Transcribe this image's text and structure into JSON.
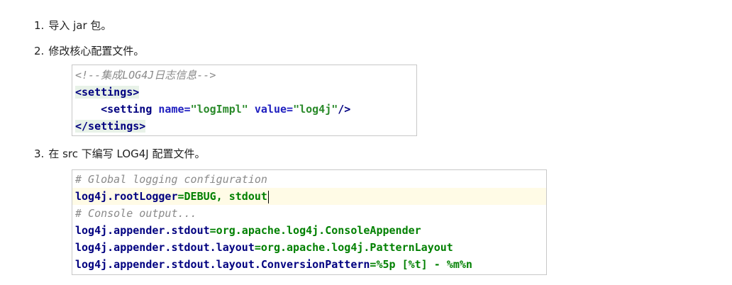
{
  "steps": [
    {
      "num": "1.",
      "text": "导入 jar 包。"
    },
    {
      "num": "2.",
      "text": "修改核心配置文件。"
    },
    {
      "num": "3.",
      "text": "在 src 下编写 LOG4J 配置文件。"
    }
  ],
  "xml_code": {
    "comment": "<!--集成LOG4J日志信息-->",
    "open_tag": "<settings>",
    "setting_open": "<setting ",
    "attr_name": "name=",
    "attr_name_val": "\"logImpl\"",
    "attr_value": " value=",
    "attr_value_val": "\"log4j\"",
    "setting_close": "/>",
    "close_tag": "</settings>"
  },
  "props_code": {
    "comment1": "# Global logging configuration",
    "line1_key": "log4j.rootLogger",
    "line1_val": "=DEBUG, stdout",
    "comment2": "# Console output...",
    "line2_key": "log4j.appender.stdout",
    "line2_val": "=org.apache.log4j.ConsoleAppender",
    "line3_key": "log4j.appender.stdout.layout",
    "line3_val": "=org.apache.log4j.PatternLayout",
    "line4_key": "log4j.appender.stdout.layout.ConversionPattern",
    "line4_val": "=%5p [%t] - %m%n"
  }
}
